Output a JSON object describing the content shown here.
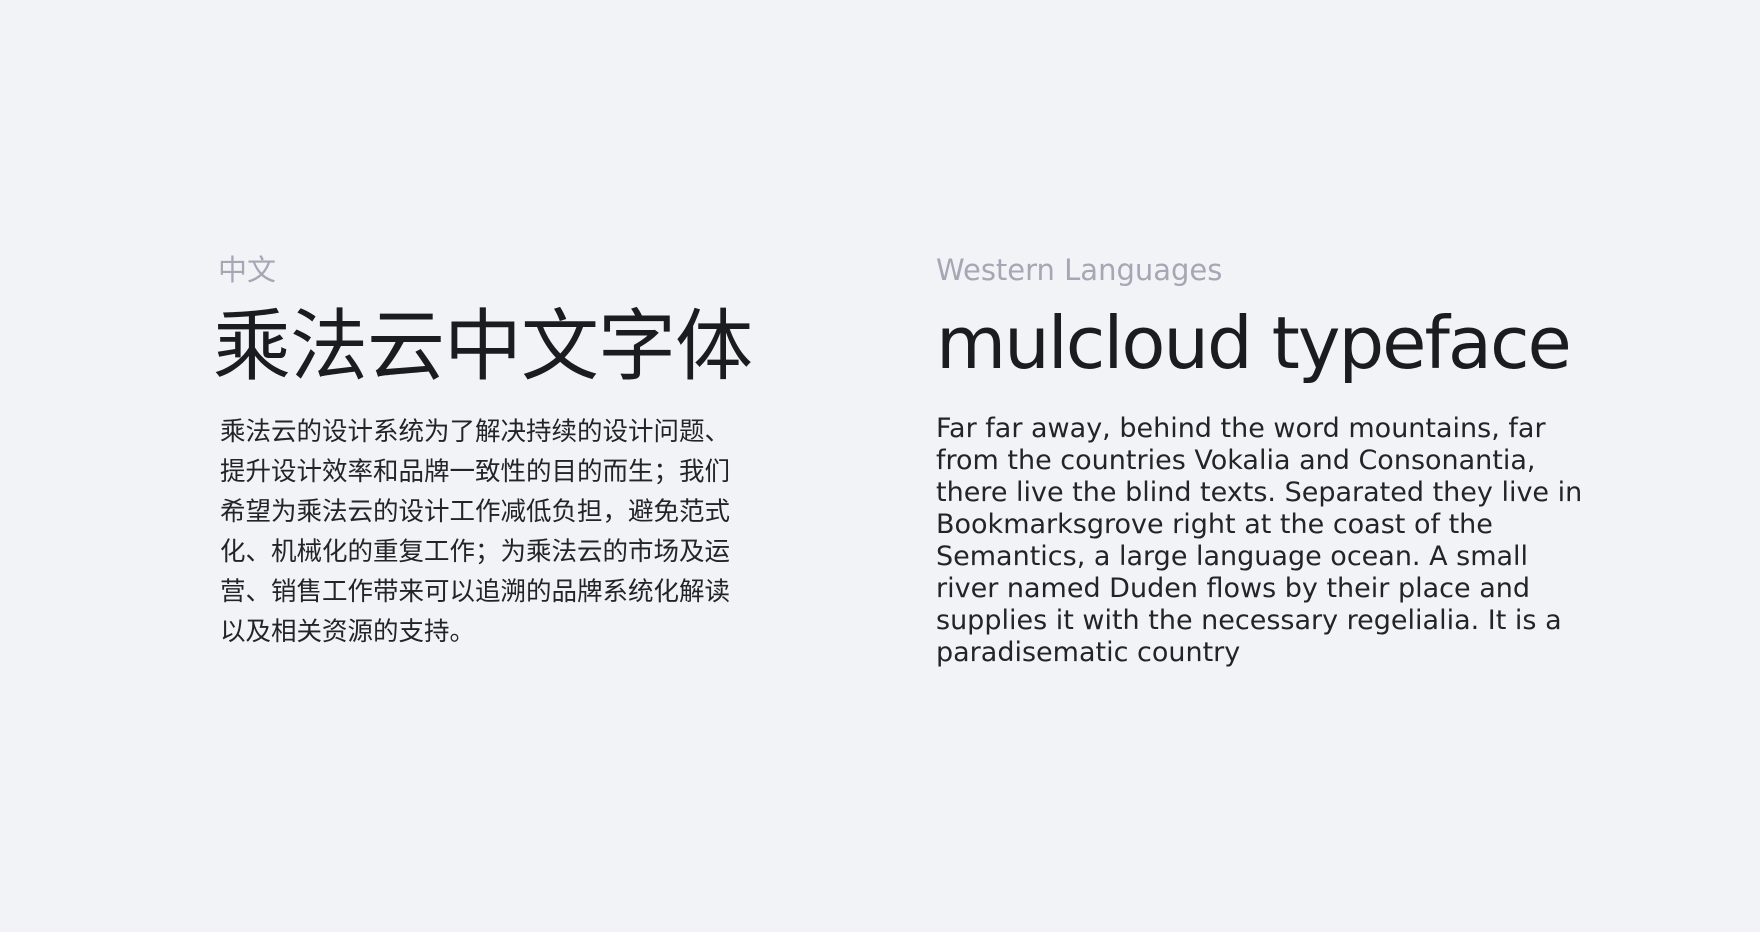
{
  "chinese": {
    "label": "中文",
    "title": "乘法云中文字体",
    "body": "乘法云的设计系统为了解决持续的设计问题、提升设计效率和品牌一致性的目的而生；我们希望为乘法云的设计工作减低负担，避免范式化、机械化的重复工作；为乘法云的市场及运营、销售工作带来可以追溯的品牌系统化解读以及相关资源的支持。"
  },
  "western": {
    "label": "Western Languages",
    "title": "mulcloud typeface",
    "body_lines": [
      "Far far away, behind the word mountains, far",
      "from the countries Vokalia and Consonantia,",
      "there live the blind texts. Separated they live in",
      "Bookmarksgrove right at the coast of the",
      "Semantics, a large language ocean. A small",
      "river named Duden flows by their place and",
      "supplies it with the necessary regelialia. It is a",
      "paradisematic country"
    ]
  }
}
